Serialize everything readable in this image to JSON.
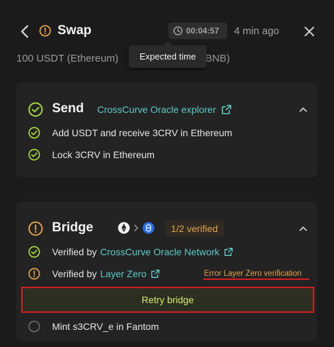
{
  "header": {
    "title": "Swap",
    "timer": "00:04:57",
    "ago": "4 min ago"
  },
  "subtitle": {
    "from": "100 USDT (Ethereum)",
    "to": "BNB)"
  },
  "tooltip": "Expected time",
  "send": {
    "title": "Send",
    "explorer_label": "CrossCurve Oracle explorer",
    "steps": [
      {
        "label": "Add USDT and receive 3CRV in Ethereum"
      },
      {
        "label": "Lock 3CRV in Ethereum"
      }
    ]
  },
  "bridge": {
    "title": "Bridge",
    "verified_badge": "1/2 verified",
    "steps": [
      {
        "prefix": "Verified by",
        "link": "CrossCurve Oracle Network"
      },
      {
        "prefix": "Verified by",
        "link": "Layer Zero"
      }
    ],
    "error": "Error Layer Zero verification",
    "retry_label": "Retry bridge",
    "mint_label": "Mint s3CRV_e in Fantom"
  },
  "colors": {
    "success": "#a6d93a",
    "warning": "#e3a14b",
    "link": "#5ccbc6",
    "highlight": "#d62020",
    "retry_text": "#d8ec6a"
  },
  "icons": {
    "back": "chevron-left-icon",
    "status": "warning-circle-icon",
    "timer": "clock-icon",
    "close": "close-icon",
    "success": "check-circle-icon",
    "external": "external-link-icon",
    "collapse": "chevron-up-icon",
    "ethereum": "ethereum-icon",
    "fantom": "fantom-icon",
    "pending": "empty-circle-icon"
  }
}
